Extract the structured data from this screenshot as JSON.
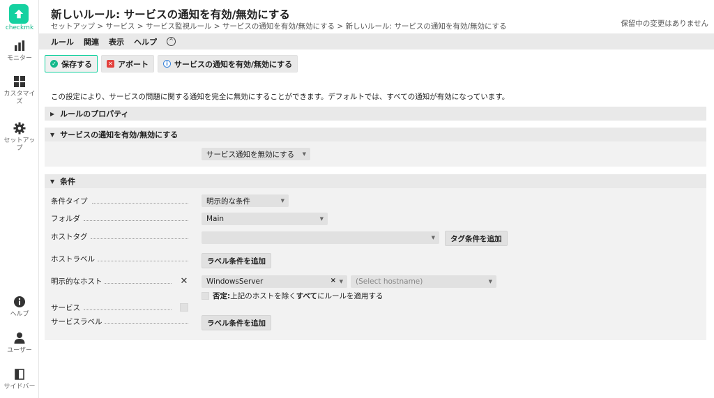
{
  "sidebar": {
    "logo_text": "checkmk",
    "items": [
      {
        "label": "モニター",
        "icon": "bar-chart-icon"
      },
      {
        "label": "カスタマイズ",
        "icon": "grid-icon"
      },
      {
        "label": "セットアップ",
        "icon": "gear-icon"
      },
      {
        "label": "ヘルプ",
        "icon": "info-icon"
      },
      {
        "label": "ユーザー",
        "icon": "user-icon"
      },
      {
        "label": "サイドバー",
        "icon": "sidebar-icon"
      }
    ],
    "label_lines": {
      "customize": [
        "カスタマイ",
        "ズ"
      ],
      "setup": [
        "セットアッ",
        "プ"
      ]
    }
  },
  "header": {
    "title": "新しいルール: サービスの通知を有効/無効にする",
    "breadcrumb": "セットアップ > サービス > サービス監視ルール > サービスの通知を有効/無効にする > 新しいルール: サービスの通知を有効/無効にする",
    "pending": "保留中の変更はありません"
  },
  "menubar": {
    "items": [
      "ルール",
      "関連",
      "表示",
      "ヘルプ"
    ]
  },
  "actions": {
    "save": "保存する",
    "abort": "アボート",
    "toggle": "サービスの通知を有効/無効にする"
  },
  "description": "この設定により、サービスの問題に関する通知を完全に無効にすることができます。デフォルトでは、すべての通知が有効になっています。",
  "sections": {
    "properties": "ルールのプロパティ",
    "value": "サービスの通知を有効/無効にする",
    "conditions": "条件"
  },
  "value": {
    "selected": "サービス通知を無効にする"
  },
  "conditions": {
    "type_label": "条件タイプ",
    "type_value": "明示的な条件",
    "folder_label": "フォルダ",
    "folder_value": "Main",
    "hosttags_label": "ホストタグ",
    "hosttags_value": "",
    "add_tag_button": "タグ条件を追加",
    "hostlabels_label": "ホストラベル",
    "add_label_button": "ラベル条件を追加",
    "explicit_hosts_label": "明示的なホスト",
    "host_value": "WindowsServer",
    "host_placeholder": "(Select hostname)",
    "negate_prefix": "否定:",
    "negate_text": " 上記のホストを除く",
    "negate_all": "すべて",
    "negate_suffix": "にルールを適用する",
    "services_label": "サービス",
    "servicelabels_label": "サービスラベル",
    "add_service_label_button": "ラベル条件を追加"
  },
  "colors": {
    "accent": "#15d1a0",
    "abort": "#e3413d",
    "info": "#3480d9"
  }
}
